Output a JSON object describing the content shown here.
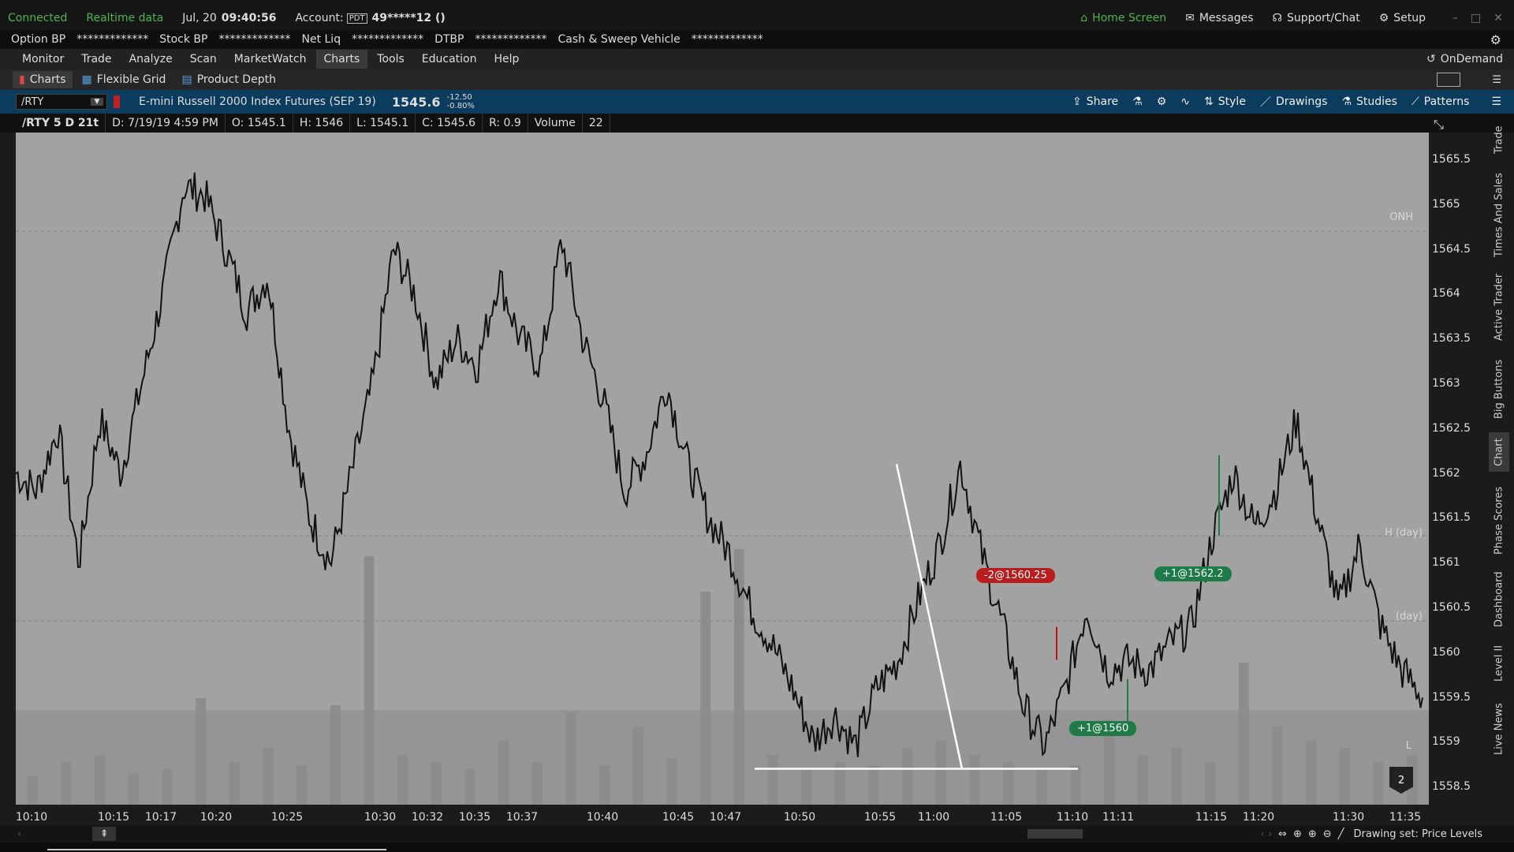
{
  "status": {
    "connected": "Connected",
    "realtime": "Realtime data",
    "date": "Jul, 20",
    "time": "09:40:56",
    "account_label": "Account:",
    "account_badge": "PDT",
    "account_value": "49*****12 ()",
    "home": "Home Screen",
    "messages": "Messages",
    "support": "Support/Chat",
    "setup": "Setup"
  },
  "balances": [
    {
      "label": "Option BP",
      "value": "*************"
    },
    {
      "label": "Stock BP",
      "value": "*************"
    },
    {
      "label": "Net Liq",
      "value": "*************"
    },
    {
      "label": "DTBP",
      "value": "*************"
    },
    {
      "label": "Cash & Sweep Vehicle",
      "value": "*************"
    }
  ],
  "nav": {
    "items": [
      "Monitor",
      "Trade",
      "Analyze",
      "Scan",
      "MarketWatch",
      "Charts",
      "Tools",
      "Education",
      "Help"
    ],
    "active": "Charts",
    "ondemand": "OnDemand"
  },
  "subtabs": [
    "Charts",
    "Flexible Grid",
    "Product Depth"
  ],
  "symbol": {
    "ticker": "/RTY",
    "name": "E-mini Russell 2000 Index Futures (SEP 19)",
    "price": "1545.6",
    "change": "-12.50",
    "change_pct": "-0.80%"
  },
  "toolbar": {
    "share": "Share",
    "style": "Style",
    "drawings": "Drawings",
    "studies": "Studies",
    "patterns": "Patterns"
  },
  "bar_info": {
    "chart": "/RTY 5 D 21t",
    "d": "D: 7/19/19 4:59 PM",
    "o": "O: 1545.1",
    "h": "H: 1546",
    "l": "L: 1545.1",
    "c": "C: 1545.6",
    "r": "R: 0.9",
    "volume_label": "Volume",
    "volume": "22"
  },
  "side_tabs": [
    "Trade",
    "Times And Sales",
    "Active Trader",
    "Big Buttons",
    "Chart",
    "Phase Scores",
    "Dashboard",
    "Level II",
    "Live News"
  ],
  "side_active": "Chart",
  "chart_levels": {
    "onh": "ONH",
    "hday": "H (day)",
    "lday": "(day)",
    "l": "L"
  },
  "orders": [
    {
      "text": "-2@1560.25",
      "color": "#b81c1c"
    },
    {
      "text": "+1@1562.2",
      "color": "#1e7a46"
    },
    {
      "text": "+1@1560",
      "color": "#1e7a46"
    }
  ],
  "badge": "2",
  "footer": {
    "drawing_set": "Drawing set: Price Levels"
  },
  "chart_data": {
    "type": "line",
    "title": "E-mini Russell 2000 Index Futures (SEP 19)",
    "ylim": [
      1558.3,
      1565.8
    ],
    "yticks": [
      "1565.5",
      "1565",
      "1564.5",
      "1564",
      "1563.5",
      "1563",
      "1562.5",
      "1562",
      "1561.5",
      "1561",
      "1560.5",
      "1560",
      "1559.5",
      "1559",
      "1558.5"
    ],
    "xticks": [
      "10:10",
      "10:15",
      "10:17",
      "10:20",
      "10:25",
      "10:30",
      "10:32",
      "10:35",
      "10:37",
      "10:40",
      "10:45",
      "10:47",
      "10:50",
      "10:55",
      "11:00",
      "11:05",
      "11:10",
      "11:11",
      "11:15",
      "11:20",
      "11:30",
      "11:35"
    ],
    "levels": {
      "ONH": 1564.7,
      "H (day)": 1561.3,
      "(day)": 1560.35
    },
    "series": [
      {
        "values": [
          1562,
          1561.8,
          1562.5,
          1561,
          1562.6,
          1562,
          1563,
          1564,
          1565.2,
          1565.1,
          1564.5,
          1563.8,
          1564.2,
          1562.5,
          1561.5,
          1561,
          1562,
          1563,
          1564.5,
          1564,
          1563,
          1563.5,
          1563.2,
          1564.2,
          1563.5,
          1563.2,
          1564.6,
          1563.5,
          1562.8,
          1561.8,
          1562.2,
          1563,
          1562.1,
          1561.5,
          1561.1,
          1560.5,
          1560.1,
          1559.6,
          1559,
          1559.3,
          1558.95,
          1559.6,
          1559.9,
          1560.6,
          1561.2,
          1562.1,
          1561.1,
          1560.3,
          1559.4,
          1558.95,
          1559.6,
          1560.5,
          1559.8,
          1559.9,
          1559.8,
          1560.1,
          1560.3,
          1561.3,
          1562,
          1561.4,
          1561.8,
          1562.6,
          1561.5,
          1560.5,
          1561.2,
          1560.3,
          1559.8,
          1559.5
        ]
      }
    ],
    "volume": [
      8,
      12,
      14,
      9,
      10,
      30,
      12,
      16,
      11,
      28,
      70,
      14,
      12,
      10,
      18,
      12,
      26,
      11,
      22,
      13,
      60,
      72,
      14,
      10,
      12,
      11,
      16,
      18,
      14,
      12,
      10,
      11,
      24,
      14,
      16,
      12,
      40,
      22,
      18,
      16,
      12,
      14
    ],
    "orders": [
      {
        "label": "-2@1560.25",
        "price": 1560.25
      },
      {
        "label": "+1@1562.2",
        "price": 1562.2
      },
      {
        "label": "+1@1560",
        "price": 1560
      }
    ],
    "drawings": [
      {
        "type": "trendline",
        "from": [
          "10:54",
          1562.1
        ],
        "to": [
          "10:58",
          1558.7
        ]
      },
      {
        "type": "horizontal",
        "price": 1558.7,
        "from": "10:48",
        "to": "11:10"
      }
    ]
  }
}
